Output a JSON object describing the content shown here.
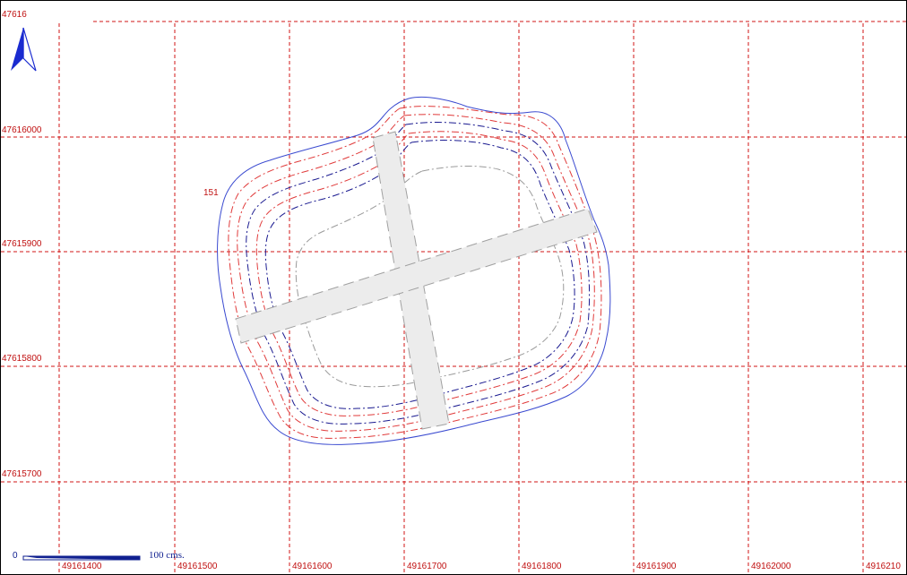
{
  "map": {
    "elevation_label": "151",
    "colors": {
      "grid": "#d01414",
      "outline": "#3a4ad0",
      "contour_red": "#e03a3a",
      "contour_blue": "#1a1a90",
      "contour_grey": "#9a9a9a",
      "north_arrow": "#1a2bd0"
    }
  },
  "axis": {
    "y_labels": [
      "47616",
      "47616000",
      "47615900",
      "47615800",
      "47615700"
    ],
    "x_labels": [
      "49161400",
      "49161500",
      "49161600",
      "49161700",
      "49161800",
      "49161900",
      "49162000",
      "4916210"
    ]
  },
  "scale_bar": {
    "zero": "0",
    "label": "100  cms."
  },
  "icons": {
    "north_arrow": "north-arrow-icon"
  }
}
